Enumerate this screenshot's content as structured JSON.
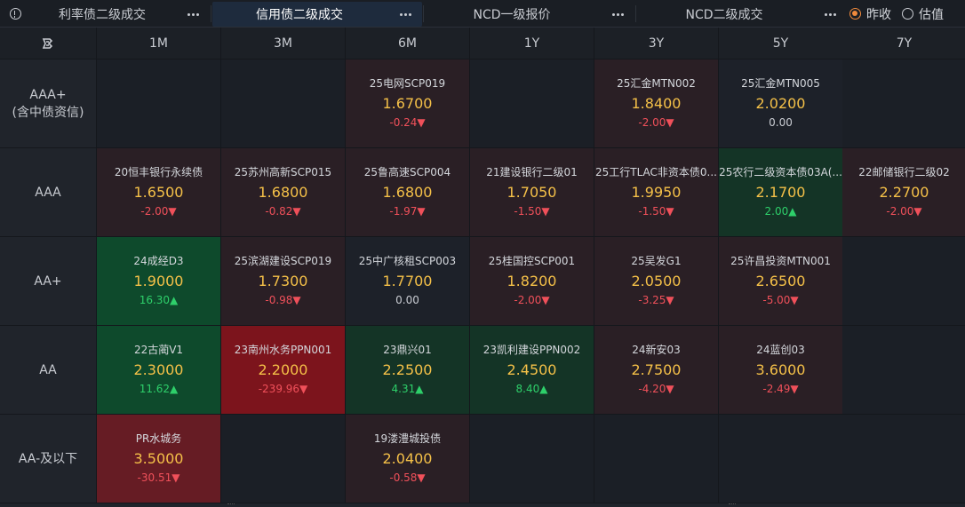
{
  "tabs": [
    {
      "label": "利率债二级成交",
      "active": false
    },
    {
      "label": "信用债二级成交",
      "active": true
    },
    {
      "label": "NCD一级报价",
      "active": false
    },
    {
      "label": "NCD二级成交",
      "active": false
    }
  ],
  "radios": [
    {
      "label": "昨收",
      "checked": true
    },
    {
      "label": "估值",
      "checked": false
    }
  ],
  "columns": [
    "1M",
    "3M",
    "6M",
    "1Y",
    "3Y",
    "5Y",
    "7Y"
  ],
  "rows": [
    {
      "label": "AAA+",
      "sublabel": "(含中债资信)"
    },
    {
      "label": "AAA",
      "sublabel": ""
    },
    {
      "label": "AA+",
      "sublabel": ""
    },
    {
      "label": "AA",
      "sublabel": ""
    },
    {
      "label": "AA-及以下",
      "sublabel": ""
    }
  ],
  "cells": [
    [
      null,
      null,
      {
        "name": "25电网SCP019",
        "price": "1.6700",
        "change": "-0.24▼",
        "dir": "down",
        "tone": "neg"
      },
      null,
      {
        "name": "25汇金MTN002",
        "price": "1.8400",
        "change": "-2.00▼",
        "dir": "down",
        "tone": "neg"
      },
      {
        "name": "25汇金MTN005",
        "price": "2.0200",
        "change": "0.00",
        "dir": "flat",
        "tone": "neu"
      },
      null
    ],
    [
      {
        "name": "20恒丰银行永续债",
        "price": "1.6500",
        "change": "-2.00▼",
        "dir": "down",
        "tone": "neg"
      },
      {
        "name": "25苏州高新SCP015",
        "price": "1.6800",
        "change": "-0.82▼",
        "dir": "down",
        "tone": "neg"
      },
      {
        "name": "25鲁高速SCP004",
        "price": "1.6800",
        "change": "-1.97▼",
        "dir": "down",
        "tone": "neg"
      },
      {
        "name": "21建设银行二级01",
        "price": "1.7050",
        "change": "-1.50▼",
        "dir": "down",
        "tone": "neg"
      },
      {
        "name": "25工行TLAC非资本债0...",
        "price": "1.9950",
        "change": "-1.50▼",
        "dir": "down",
        "tone": "neg"
      },
      {
        "name": "25农行二级资本债03A(...",
        "price": "2.1700",
        "change": "2.00▲",
        "dir": "up",
        "tone": "pos"
      },
      {
        "name": "22邮储银行二级02",
        "price": "2.2700",
        "change": "-2.00▼",
        "dir": "down",
        "tone": "neg"
      }
    ],
    [
      {
        "name": "24成经D3",
        "price": "1.9000",
        "change": "16.30▲",
        "dir": "up",
        "tone": "pos2"
      },
      {
        "name": "25滨湖建设SCP019",
        "price": "1.7300",
        "change": "-0.98▼",
        "dir": "down",
        "tone": "neg"
      },
      {
        "name": "25中广核租SCP003",
        "price": "1.7700",
        "change": "0.00",
        "dir": "flat",
        "tone": "neu"
      },
      {
        "name": "25桂国控SCP001",
        "price": "1.8200",
        "change": "-2.00▼",
        "dir": "down",
        "tone": "neg"
      },
      {
        "name": "25吴发G1",
        "price": "2.0500",
        "change": "-3.25▼",
        "dir": "down",
        "tone": "neg"
      },
      {
        "name": "25许昌投资MTN001",
        "price": "2.6500",
        "change": "-5.00▼",
        "dir": "down",
        "tone": "neg"
      },
      null
    ],
    [
      {
        "name": "22古蔺V1",
        "price": "2.3000",
        "change": "11.62▲",
        "dir": "up",
        "tone": "pos2"
      },
      {
        "name": "23南州水务PPN001",
        "price": "2.2000",
        "change": "-239.96▼",
        "dir": "down",
        "tone": "neg3"
      },
      {
        "name": "23鼎兴01",
        "price": "2.2500",
        "change": "4.31▲",
        "dir": "up",
        "tone": "pos"
      },
      {
        "name": "23凯利建设PPN002",
        "price": "2.4500",
        "change": "8.40▲",
        "dir": "up",
        "tone": "pos"
      },
      {
        "name": "24新安03",
        "price": "2.7500",
        "change": "-4.20▼",
        "dir": "down",
        "tone": "neg"
      },
      {
        "name": "24蓝创03",
        "price": "3.6000",
        "change": "-2.49▼",
        "dir": "down",
        "tone": "neg"
      },
      null
    ],
    [
      {
        "name": "PR水城务",
        "price": "3.5000",
        "change": "-30.51▼",
        "dir": "down",
        "tone": "neg2"
      },
      null,
      {
        "name": "19溇澧城投债",
        "price": "2.0400",
        "change": "-0.58▼",
        "dir": "down",
        "tone": "neg"
      },
      null,
      null,
      null,
      null
    ]
  ]
}
